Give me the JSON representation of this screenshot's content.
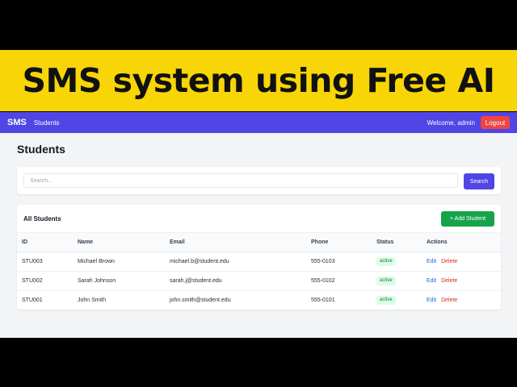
{
  "banner": {
    "title": "SMS system using Free AI"
  },
  "navbar": {
    "brand": "SMS",
    "nav_link": "Students",
    "welcome": "Welcome, admin",
    "logout_label": "Logout"
  },
  "page": {
    "title": "Students"
  },
  "search": {
    "placeholder": "Search...",
    "value": "",
    "button_label": "Search"
  },
  "table": {
    "title": "All Students",
    "add_button_label": "+ Add Student",
    "columns": {
      "id": "ID",
      "name": "Name",
      "email": "Email",
      "phone": "Phone",
      "status": "Status",
      "actions": "Actions"
    },
    "rows": [
      {
        "id": "STU003",
        "name": "Michael Brown",
        "email": "michael.b@student.edu",
        "phone": "555-0103",
        "status": "active",
        "edit": "Edit",
        "delete": "Delete"
      },
      {
        "id": "STU002",
        "name": "Sarah Johnson",
        "email": "sarah.j@student.edu",
        "phone": "555-0102",
        "status": "active",
        "edit": "Edit",
        "delete": "Delete"
      },
      {
        "id": "STU001",
        "name": "John Smith",
        "email": "john.smith@student.edu",
        "phone": "555-0101",
        "status": "active",
        "edit": "Edit",
        "delete": "Delete"
      }
    ]
  },
  "colors": {
    "banner_bg": "#f7d506",
    "navbar_bg": "#5046e5",
    "logout_bg": "#ef4444",
    "search_button_bg": "#4f46e5",
    "add_button_bg": "#16a34a",
    "status_active_bg": "#dcfce7",
    "edit_link": "#2563eb",
    "delete_link": "#dc2626"
  }
}
